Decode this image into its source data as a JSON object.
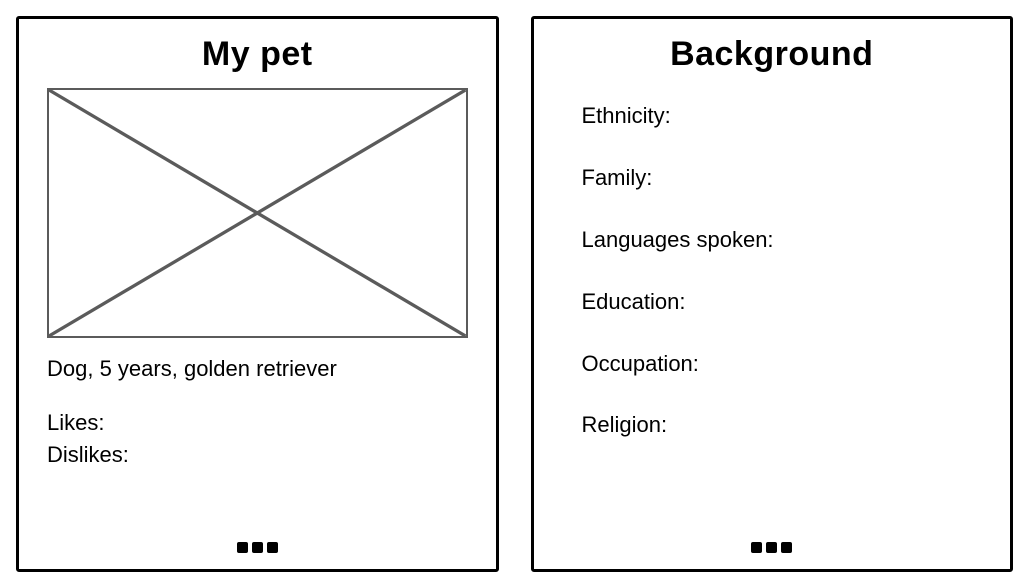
{
  "pet_card": {
    "title": "My pet",
    "details": "Dog, 5 years, golden retriever",
    "likes_label": "Likes:",
    "dislikes_label": "Dislikes:"
  },
  "background_card": {
    "title": "Background",
    "fields": {
      "ethnicity": "Ethnicity:",
      "family": "Family:",
      "languages": "Languages spoken:",
      "education": "Education:",
      "occupation": "Occupation:",
      "religion": "Religion:"
    }
  }
}
